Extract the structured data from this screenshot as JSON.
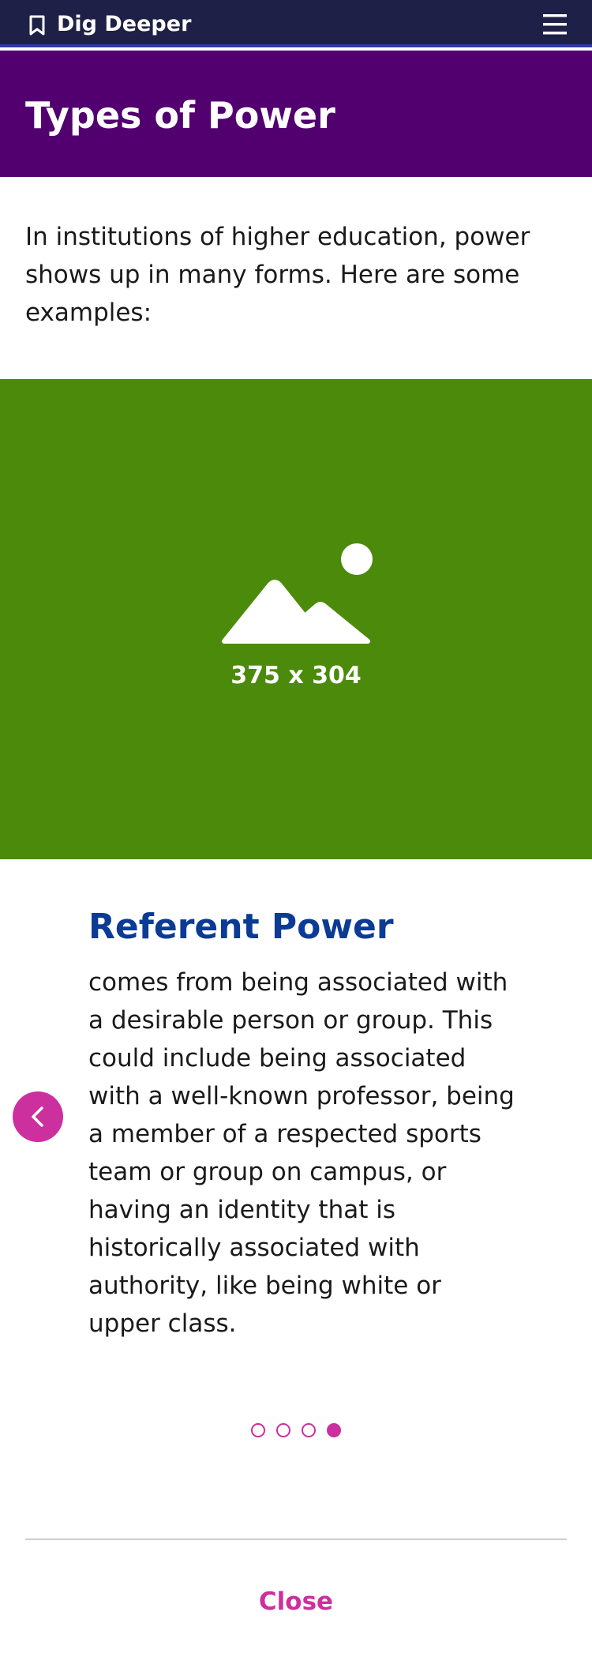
{
  "topbar": {
    "title": "Dig Deeper",
    "icons": {
      "bookmark": "bookmark-icon",
      "menu": "hamburger-menu-icon"
    },
    "background": "#1e2047"
  },
  "header": {
    "title": "Types of Power",
    "close_icon": "close-circle-icon",
    "background": "#520070"
  },
  "intro": {
    "text": "In institutions of higher education, power shows up in many forms. Here are some examples:"
  },
  "hero": {
    "caption": "375 x 304",
    "icon": "image-placeholder-icon",
    "background": "#4c8a0b"
  },
  "slide": {
    "title": "Referent Power",
    "body": "comes from being associated with a desirable person or group. This could include being associated with a well-known professor, being a member of a respected sports team or group on campus, or having an identity that is historically associated with authority, like being white or upper class.",
    "prev_icon": "chevron-left-icon"
  },
  "pagination": {
    "total": 4,
    "current": 4
  },
  "footer": {
    "close_label": "Close"
  },
  "colors": {
    "accent": "#cc2f9e",
    "title_blue": "#0b3b94"
  }
}
